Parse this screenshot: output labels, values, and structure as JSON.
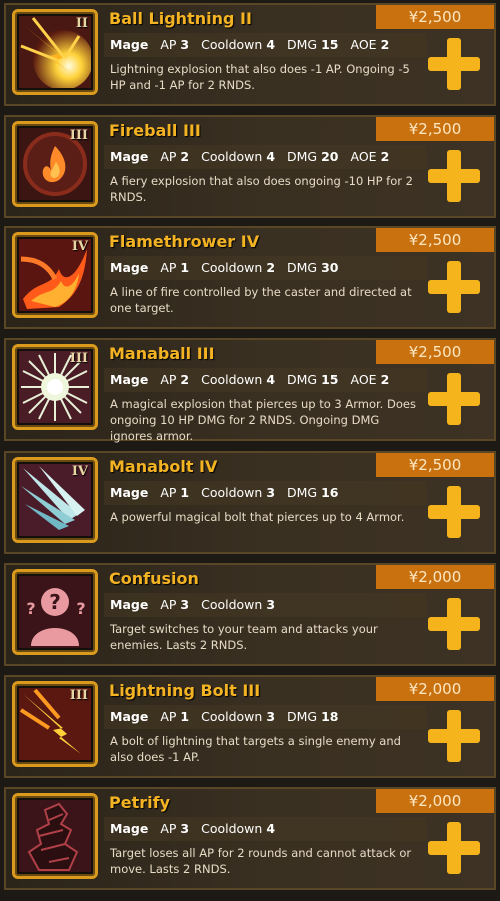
{
  "spells": [
    {
      "name": "Ball Lightning II",
      "tier": "II",
      "price": "¥2,500",
      "class": "Mage",
      "ap": "3",
      "cooldown": "4",
      "dmg": "15",
      "aoe": "2",
      "description": "Lightning explosion that also does -1 AP. Ongoing -5 HP and -1 AP for 2 RNDS.",
      "icon": "ball-lightning-icon"
    },
    {
      "name": "Fireball III",
      "tier": "III",
      "price": "¥2,500",
      "class": "Mage",
      "ap": "2",
      "cooldown": "4",
      "dmg": "20",
      "aoe": "2",
      "description": "A fiery explosion that also does ongoing -10 HP for 2 RNDS.",
      "icon": "fireball-icon"
    },
    {
      "name": "Flamethrower IV",
      "tier": "IV",
      "price": "¥2,500",
      "class": "Mage",
      "ap": "1",
      "cooldown": "2",
      "dmg": "30",
      "aoe": null,
      "description": "A line of fire controlled by the caster and directed at one target.",
      "icon": "flamethrower-icon"
    },
    {
      "name": "Manaball III",
      "tier": "III",
      "price": "¥2,500",
      "class": "Mage",
      "ap": "2",
      "cooldown": "4",
      "dmg": "15",
      "aoe": "2",
      "description": "A magical explosion that pierces up to 3 Armor. Does ongoing 10 HP DMG for 2 RNDS. Ongoing DMG ignores armor.",
      "icon": "manaball-icon"
    },
    {
      "name": "Manabolt IV",
      "tier": "IV",
      "price": "¥2,500",
      "class": "Mage",
      "ap": "1",
      "cooldown": "3",
      "dmg": "16",
      "aoe": null,
      "description": "A powerful magical bolt that pierces up to 4 Armor.",
      "icon": "manabolt-icon"
    },
    {
      "name": "Confusion",
      "tier": "",
      "price": "¥2,000",
      "class": "Mage",
      "ap": "3",
      "cooldown": "3",
      "dmg": null,
      "aoe": null,
      "description": "Target switches to your team and attacks your enemies. Lasts 2 RNDS.",
      "icon": "confusion-icon"
    },
    {
      "name": "Lightning Bolt III",
      "tier": "III",
      "price": "¥2,000",
      "class": "Mage",
      "ap": "1",
      "cooldown": "3",
      "dmg": "18",
      "aoe": null,
      "description": "A bolt of lightning that targets a single enemy and also does -1 AP.",
      "icon": "lightning-bolt-icon"
    },
    {
      "name": "Petrify",
      "tier": "",
      "price": "¥2,000",
      "class": "Mage",
      "ap": "3",
      "cooldown": "4",
      "dmg": null,
      "aoe": null,
      "description": "Target loses all AP for 2 rounds and cannot attack or move. Lasts 2 RNDS.",
      "icon": "petrify-icon"
    }
  ],
  "labels": {
    "ap": "AP",
    "cooldown": "Cooldown",
    "dmg": "DMG",
    "aoe": "AOE"
  },
  "colors": {
    "accent": "#f4b323",
    "price_bg": "#c9710f",
    "plus": "#f5b41c"
  }
}
